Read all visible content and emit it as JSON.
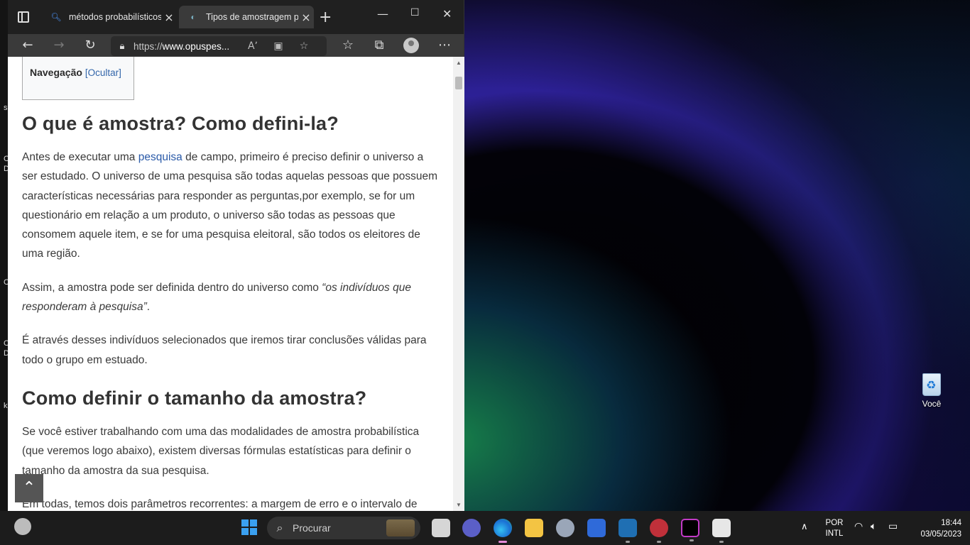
{
  "browser": {
    "tabs": [
      {
        "title": "métodos probabilísticos",
        "active": false,
        "favicon": "search-icon"
      },
      {
        "title": "Tipos de amostragem p",
        "active": true,
        "favicon": "globe-icon"
      }
    ],
    "url_prefix": "https://",
    "url_domain": "www.opuspes..."
  },
  "page": {
    "nav_label": "Navegação",
    "nav_toggle": "[Ocultar]",
    "h1": "O que é amostra? Como defini-la?",
    "p1_a": "Antes de executar uma ",
    "p1_link": "pesquisa",
    "p1_b": " de campo, primeiro é preciso definir o universo a ser estudado. O universo de uma pesquisa são todas aquelas pessoas que possuem características necessárias para responder as perguntas,por exemplo, se for um questionário em relação a um produto, o universo são todas as pessoas que consomem aquele item, e se for uma pesquisa eleitoral, são todos os eleitores de uma região.",
    "p2_a": "Assim, a amostra pode ser definida dentro do universo como ",
    "p2_em": "“os indivíduos que responderam à pesquisa”",
    "p2_b": ".",
    "p3": "É através desses indivíduos selecionados que iremos tirar conclusões válidas para todo o grupo em estuado.",
    "h2": "Como definir o tamanho da amostra?",
    "p4": "Se você estiver trabalhando com uma das modalidades de amostra probabilística (que veremos logo abaixo), existem diversas fórmulas estatísticas para definir o tamanho da amostra da sua pesquisa.",
    "p5": "Em todas, temos dois parâmetros recorrentes: a margem de erro e o intervalo de"
  },
  "desktop": {
    "recycle_label": "Você",
    "edge_letters": [
      "s",
      "C",
      "D",
      "C",
      "C",
      "D",
      "k"
    ]
  },
  "taskbar": {
    "search_placeholder": "Procurar",
    "lang_1": "POR",
    "lang_2": "INTL",
    "time": "18:44",
    "date": "03/05/2023"
  },
  "colors": {
    "link": "#2a5aa8",
    "titlebar": "#202020",
    "toolbar": "#3a3a3a",
    "taskbar": "#1c1c1c"
  }
}
